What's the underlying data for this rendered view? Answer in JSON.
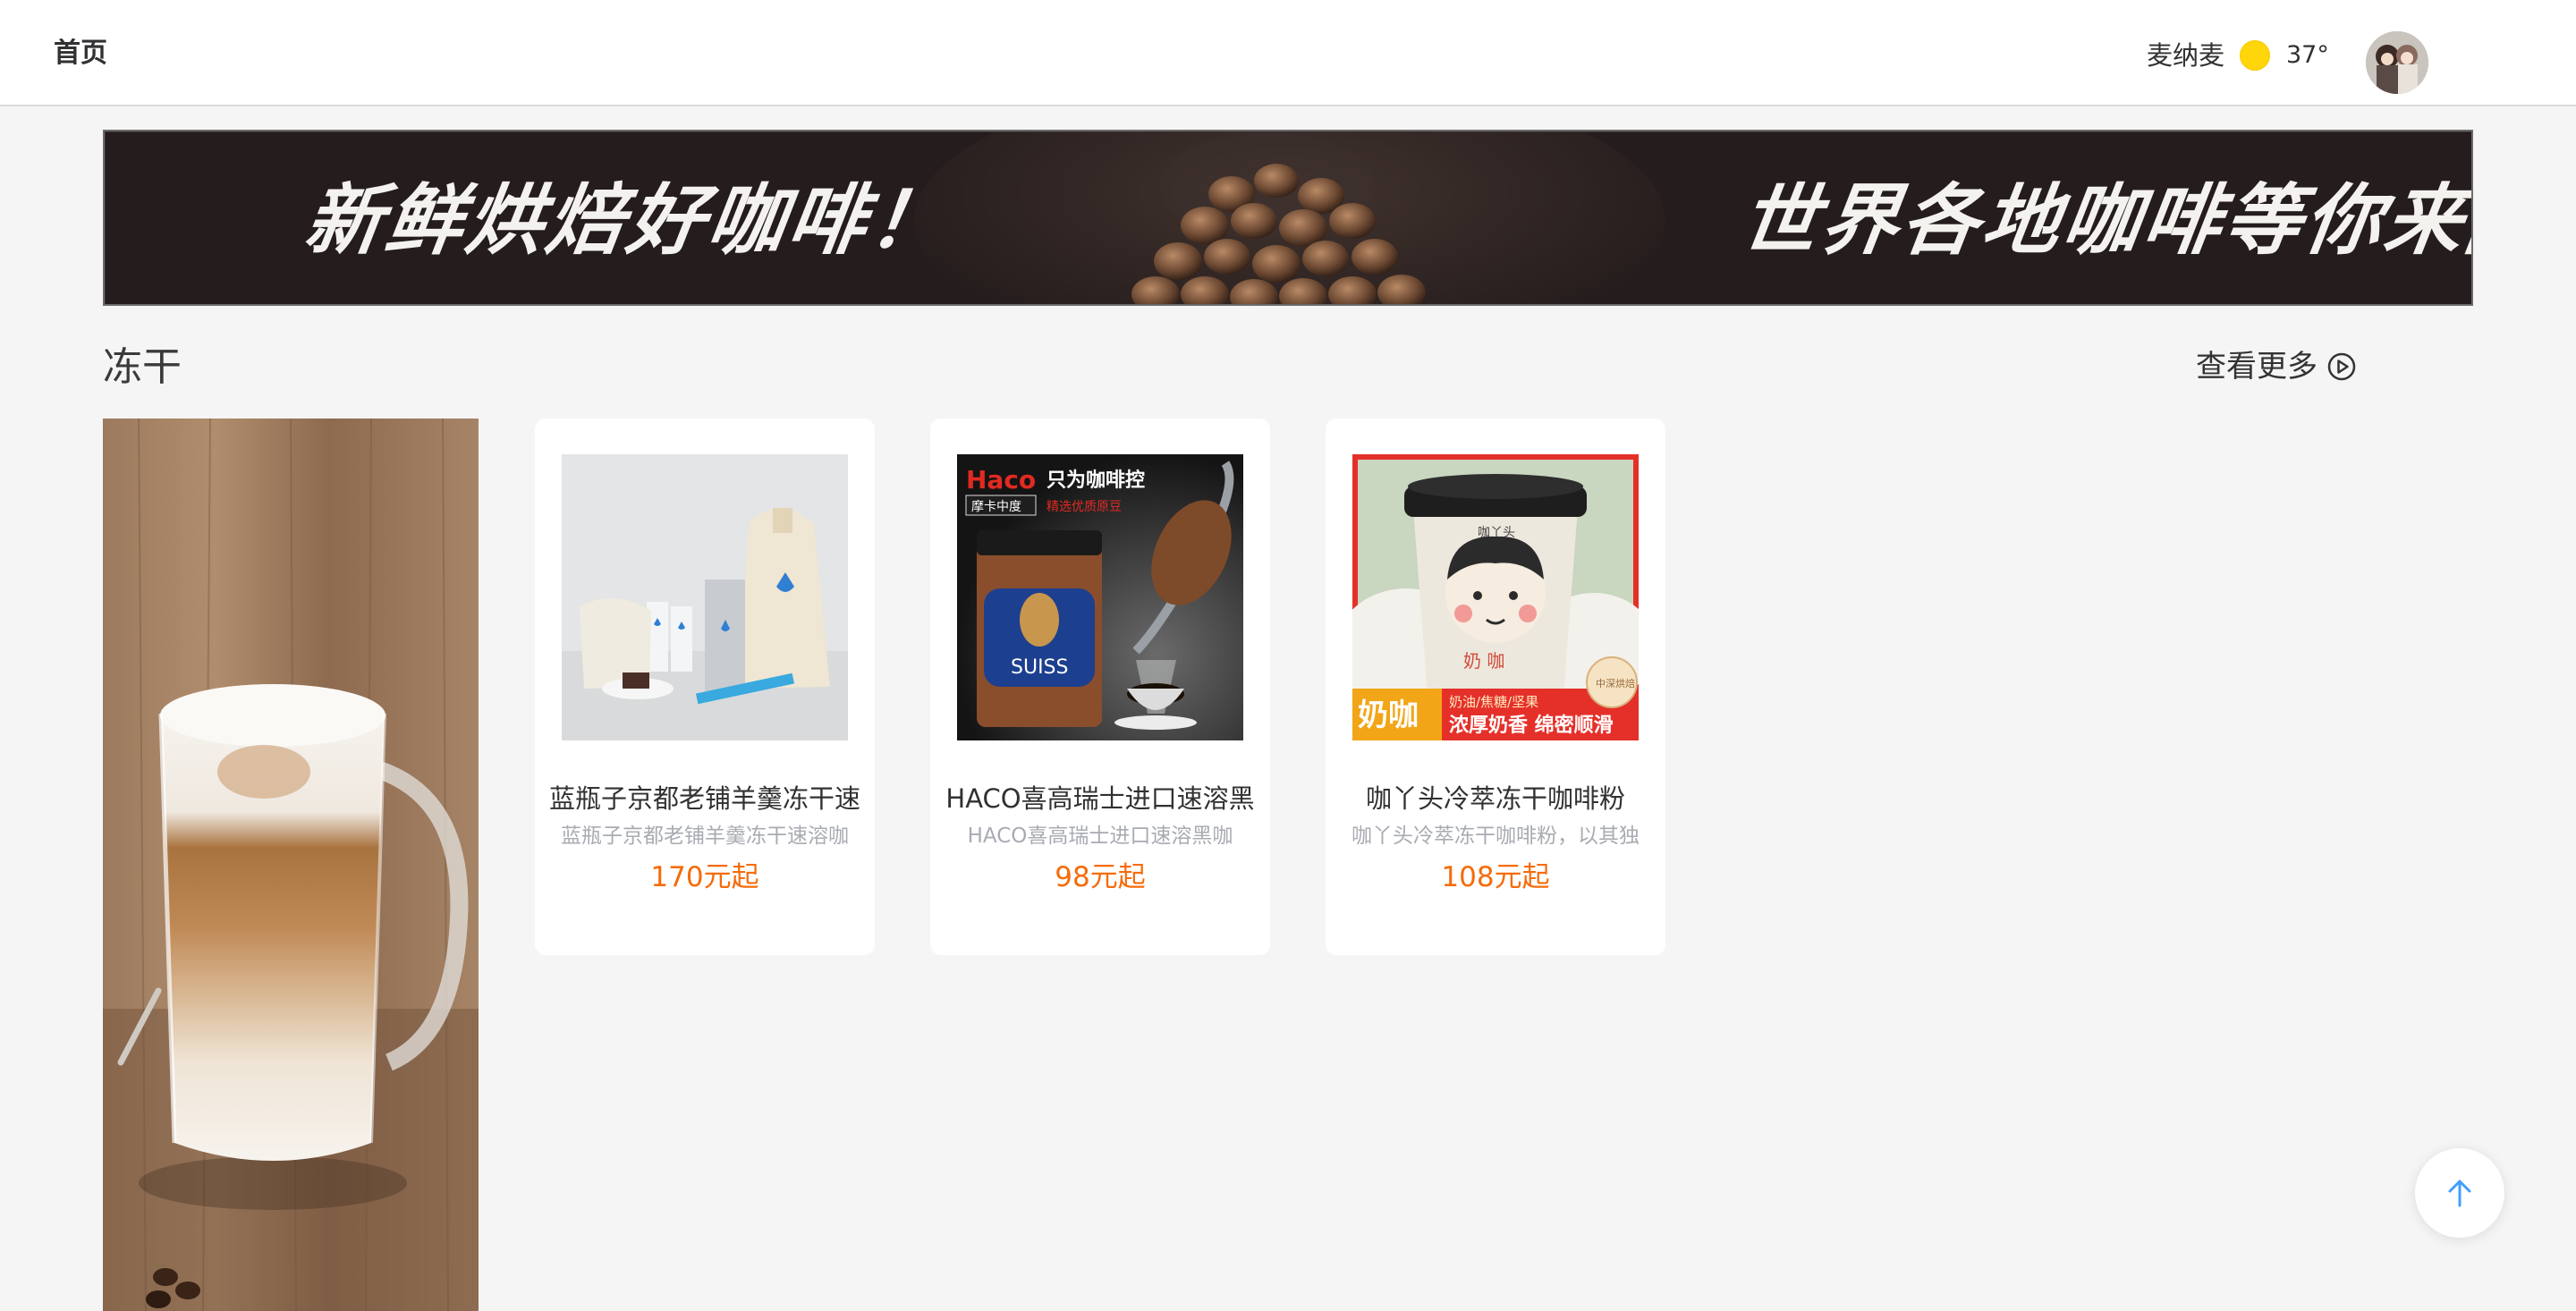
{
  "header": {
    "home_label": "首页",
    "user_name": "麦纳麦",
    "weather_icon": "sun-icon",
    "temperature": "37°",
    "avatar_icon": "avatar"
  },
  "banner": {
    "left_text": "新鲜烘焙好咖啡！",
    "right_text": "世界各地咖啡等你来品尝！"
  },
  "section": {
    "title": "冻干",
    "more_label": "查看更多",
    "more_icon": "play-circle-icon"
  },
  "products": [
    {
      "name": "蓝瓶子京都老铺羊羹冻干速",
      "desc": "蓝瓶子京都老铺羊羹冻干速溶咖",
      "price": "170元起"
    },
    {
      "name": "HACO喜高瑞士进口速溶黑",
      "desc": "HACO喜高瑞士进口速溶黑咖",
      "price": "98元起"
    },
    {
      "name": "咖丫头冷萃冻干咖啡粉",
      "desc": "咖丫头冷萃冻干咖啡粉，以其独",
      "price": "108元起"
    }
  ],
  "haco_label": {
    "brand": "Haco",
    "slogan": "只为咖啡控",
    "roast": "摩卡中度",
    "sub": "精选优质原豆",
    "can": "SUISS"
  },
  "kaya_label": {
    "tag": "奶咖",
    "line1": "奶油/焦糖/坚果",
    "line2": "浓厚奶香 绵密顺滑",
    "badge": "中深烘焙",
    "cup_top": "咖丫头",
    "cup_mid": "奶 咖"
  },
  "back_top_icon": "arrow-up-icon",
  "colors": {
    "price": "#f56c0a",
    "accent": "#409eff",
    "sun": "#ffd60a"
  }
}
